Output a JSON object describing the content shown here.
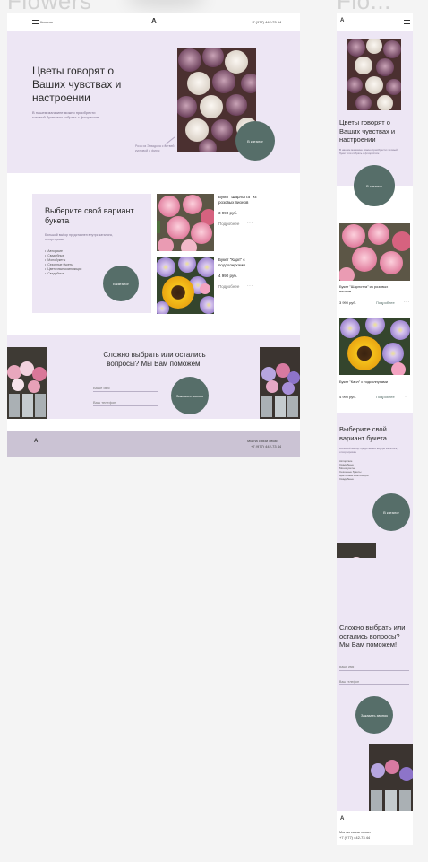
{
  "boards": {
    "desktop": "Flowers",
    "mobile": "Flo..."
  },
  "colors": {
    "lavender": "#ede6f4",
    "button": "#566e69",
    "footer": "#cbc3d4"
  },
  "icons": {
    "menu": "hamburger",
    "logo": "letter-a-logo",
    "dots": "more-dots",
    "arrow": "right-arrow"
  },
  "desktop": {
    "header": {
      "menu_label": "Каталог",
      "logo": "A",
      "phone": "+7 (977) 442-73 64"
    },
    "hero": {
      "title": "Цветы говорят о Ваших чувствах и настроении",
      "text": "В нашем магазине можно приобрести готовый букет или собрать с флористом",
      "caption": "Роза из Эквадора с ветвей кустовой и фирм",
      "button": "В каталог"
    },
    "choose": {
      "title": "Выберите свой вариант букета",
      "desc": "Большой выбор представлен внутри каталога, отсортирован",
      "list": [
        "Авторские",
        "Свадебные",
        "Монобукеты",
        "Сезонные букеты",
        "Цветочные композиции",
        "Свадебные"
      ],
      "button": "В каталог"
    },
    "products": [
      {
        "name": "Букет \"Шарлотта\" из розовых пионов",
        "price": "3 990 руб.",
        "more": "Подробнее",
        "dots": "···"
      },
      {
        "name": "Букет \"Карл\" с подсолнухами",
        "price": "4 990 руб.",
        "more": "Подробнее",
        "dots": "···"
      }
    ],
    "help": {
      "title": "Сложно выбрать или остались вопросы? Мы Вам поможем!",
      "name_placeholder": "Ваше имя",
      "phone_placeholder": "Ваш телефон",
      "button": "Заказать звонок"
    },
    "footer": {
      "logo": "A",
      "contact": "Мы на связи связи",
      "phone": "+7 (977) 442-73 44"
    }
  },
  "mobile": {
    "header": {
      "logo": "A"
    },
    "hero": {
      "title": "Цветы говорят о Ваших чувствах и настроении",
      "text": "В нашем магазине можно приобрести готовый букет или собрать с флористом",
      "button": "В каталог"
    },
    "products": [
      {
        "name": "Букет \"Шарлотта\" из розовых пионов",
        "price": "3 990 руб.",
        "more": "Подробнее",
        "dots": "···"
      },
      {
        "name": "Букет \"Карл\" с подсолнухами",
        "price": "4 990 руб.",
        "more": "Подробнее",
        "arrow": "→"
      }
    ],
    "choose": {
      "title": "Выберите свой вариант букета",
      "desc": "Большой выбор представлен внутри каталога, отсортирован",
      "list": [
        "Авторские",
        "Свадебные",
        "Монобукеты",
        "Сезонные букеты",
        "Цветочные композиции",
        "Свадебные"
      ],
      "button": "В каталог"
    },
    "help": {
      "title": "Сложно выбрать или остались вопросы? Мы Вам поможем!",
      "name_placeholder": "Ваше имя",
      "phone_placeholder": "Ваш телефон",
      "button": "Заказать звонок"
    },
    "footer": {
      "logo": "A",
      "contact": "Мы на связи связи",
      "phone": "+7 (977) 442-73 44"
    }
  }
}
